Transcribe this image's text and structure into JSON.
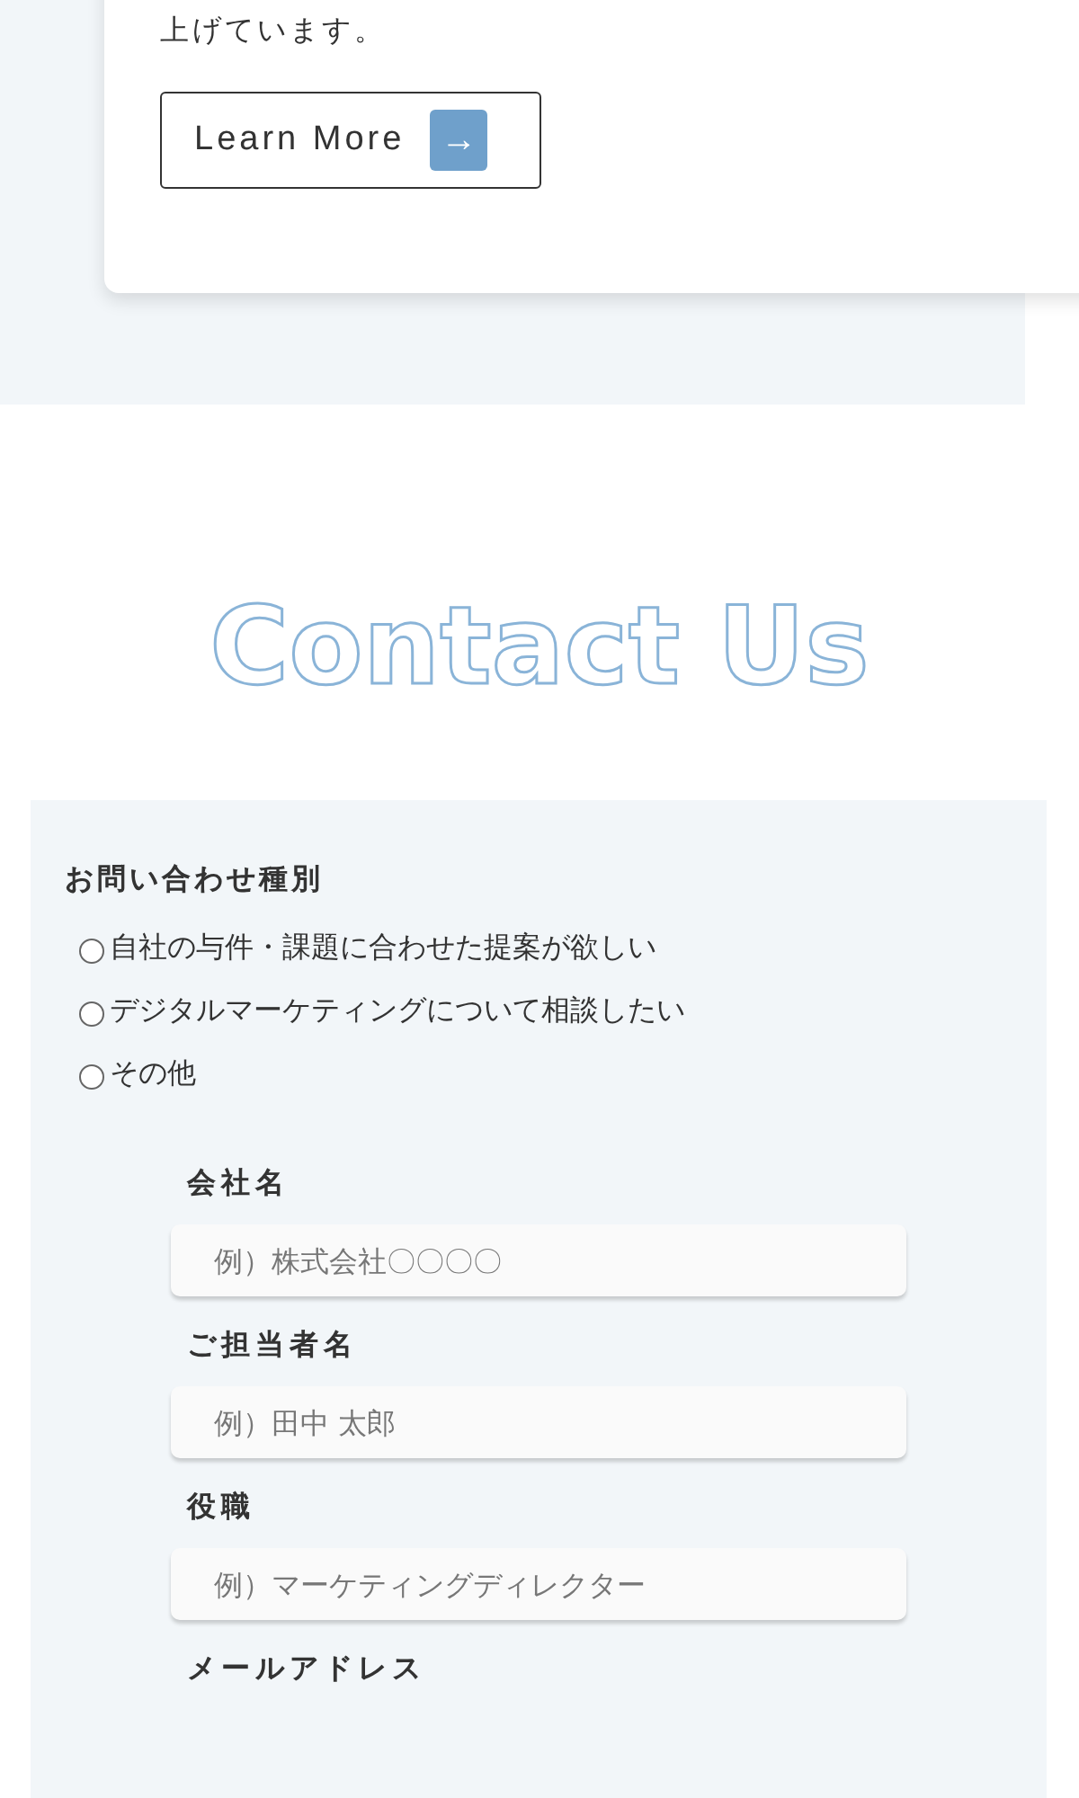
{
  "card": {
    "text": "上げています。",
    "button": {
      "label": "Learn More",
      "icon": "→"
    }
  },
  "contact": {
    "heading": "Contact Us",
    "inquiry": {
      "label": "お問い合わせ種別",
      "options": [
        {
          "label": "自社の与件・課題に合わせた提案が欲しい",
          "selected": false
        },
        {
          "label": "デジタルマーケティングについて相談したい",
          "selected": false
        },
        {
          "label": "その他",
          "selected": false
        }
      ]
    },
    "fields": [
      {
        "label": "会社名",
        "placeholder": "例）株式会社〇〇〇〇"
      },
      {
        "label": "ご担当者名",
        "placeholder": "例）田中 太郎"
      },
      {
        "label": "役職",
        "placeholder": "例）マーケティングディレクター"
      },
      {
        "label": "メールアドレス"
      }
    ]
  }
}
